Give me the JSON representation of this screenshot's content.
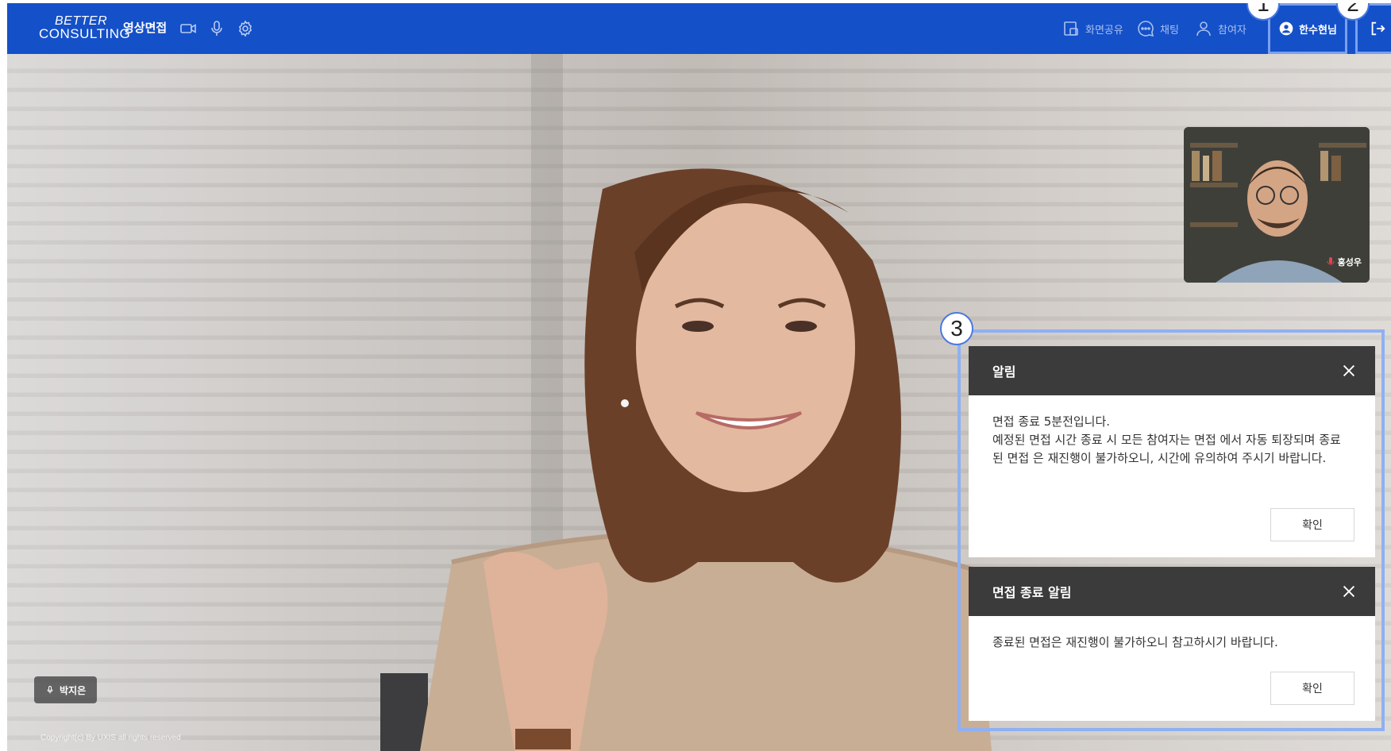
{
  "header": {
    "logo_line1": "BETTER",
    "logo_line2": "CONSULTING",
    "app_title": "영상면접",
    "screen_share": "화면공유",
    "chat": "채팅",
    "participants": "참여자",
    "user_name": "한수현님"
  },
  "markers": {
    "m1": "1",
    "m2": "2",
    "m3": "3"
  },
  "pip": {
    "name": "홍성우"
  },
  "speaker": {
    "name": "박지은"
  },
  "footer": {
    "copyright": "Copyright(c) By UXIS all rights reserved"
  },
  "dialog1": {
    "title": "알림",
    "line1": "면접 종료 5분전입니다.",
    "line2": "예정된 면접 시간 종료 시 모든 참여자는 면접 에서 자동 퇴장되며 종료된 면접 은 재진행이 불가하오니, 시간에 유의하여 주시기 바랍니다.",
    "ok": "확인"
  },
  "dialog2": {
    "title": "면접 종료 알림",
    "body": "종료된 면접은 재진행이 불가하오니 참고하시기 바랍니다.",
    "ok": "확인"
  },
  "colors": {
    "brand": "#1450c8",
    "highlight": "#8fb0f2",
    "dialog_header": "#3b3b3b"
  },
  "icons": [
    "video-icon",
    "mic-icon",
    "settings-icon",
    "screen-share-icon",
    "chat-icon",
    "participants-icon",
    "user-icon",
    "exit-icon",
    "close-icon"
  ]
}
